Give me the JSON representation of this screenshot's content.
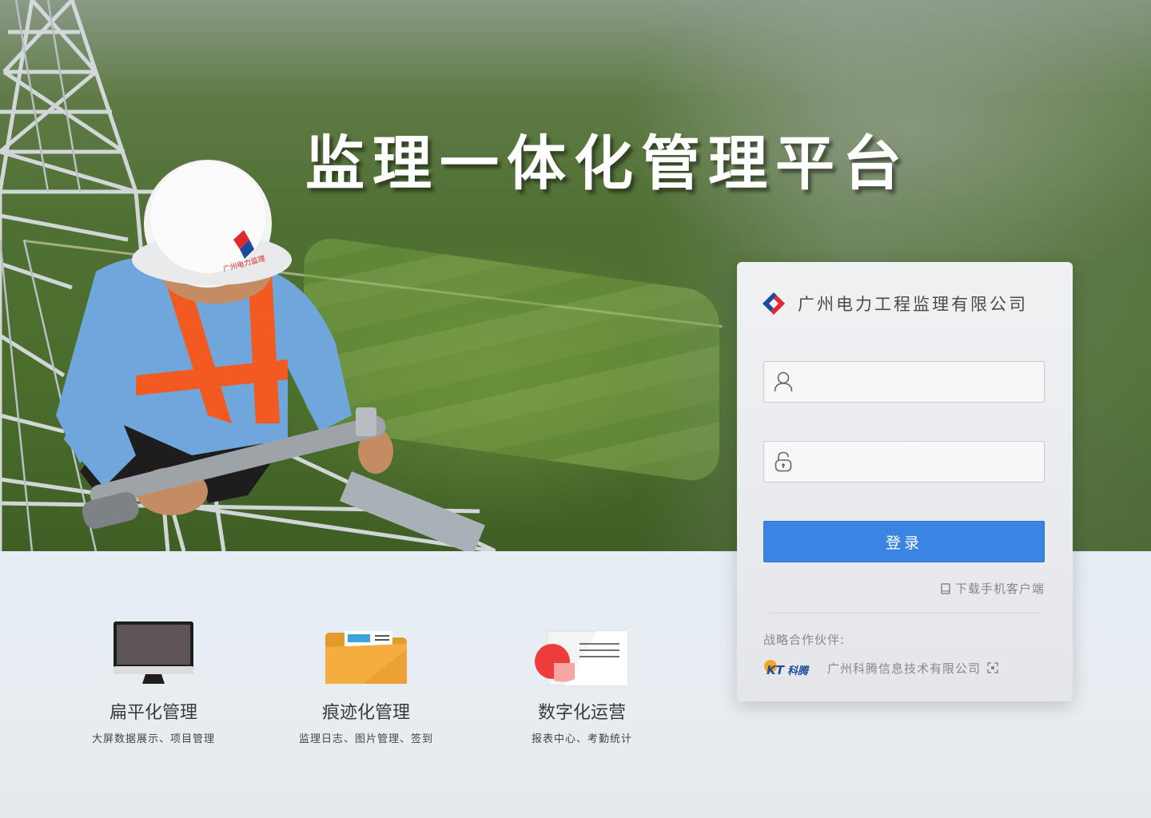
{
  "hero": {
    "title": "监理一体化管理平台",
    "helmet_logo_text": "广州电力监理"
  },
  "login": {
    "company_name": "广州电力工程监理有限公司",
    "username": {
      "value": "",
      "placeholder": ""
    },
    "password": {
      "value": "",
      "placeholder": ""
    },
    "login_button": "登录",
    "download_link": "下载手机客户端",
    "partner_label": "战略合作伙伴:",
    "partner_logo_text": "KT科腾",
    "partner_name": "广州科腾信息技术有限公司"
  },
  "features": [
    {
      "icon": "monitor-icon",
      "title": "扁平化管理",
      "subtitle": "大屏数据展示、项目管理"
    },
    {
      "icon": "folder-icon",
      "title": "痕迹化管理",
      "subtitle": "监理日志、图片管理、签到"
    },
    {
      "icon": "report-chart-icon",
      "title": "数字化运营",
      "subtitle": "报表中心、考勤统计"
    }
  ],
  "colors": {
    "login_button": "#3a84e4",
    "logo_red": "#e0282e",
    "logo_blue": "#1c4a9c",
    "folder_orange": "#f2a83b",
    "report_red": "#ee3b3b"
  }
}
